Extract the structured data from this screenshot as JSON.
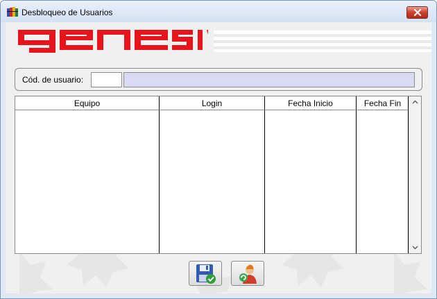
{
  "window": {
    "title": "Desbloqueo de Usuarios",
    "icons": {
      "app": "app-books-icon",
      "close": "close-icon"
    }
  },
  "header": {
    "logo_text": "genesis",
    "brand_color": "#e8141c"
  },
  "user_filter": {
    "label": "Cód. de usuario:",
    "code_value": "",
    "name_value": ""
  },
  "table": {
    "columns": [
      "Equipo",
      "Login",
      "Fecha Inicio",
      "Fecha Fin"
    ],
    "rows": []
  },
  "actions": {
    "save_icon": "save-check-icon",
    "unlock_user_icon": "user-refresh-icon"
  }
}
